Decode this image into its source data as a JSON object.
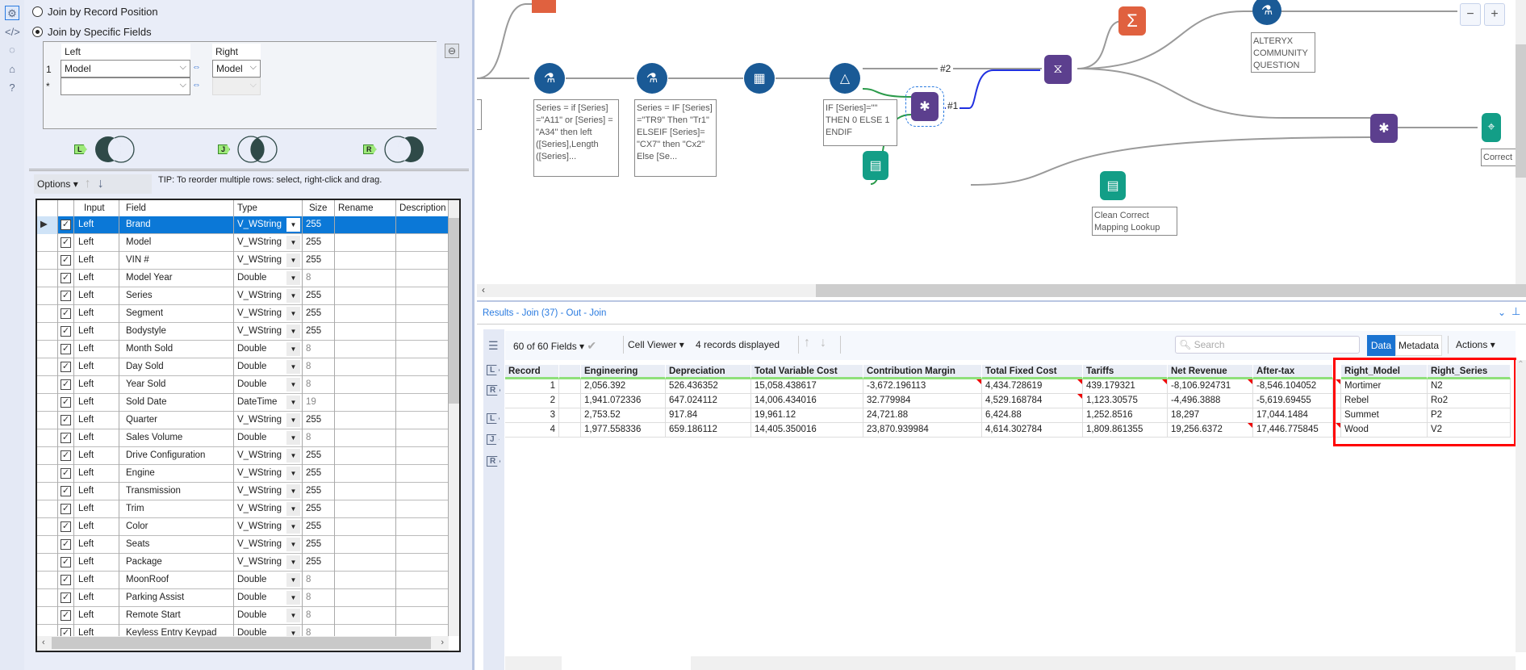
{
  "left_panel": {
    "radio_record_position": "Join by Record Position",
    "radio_specific_fields": "Join by Specific Fields",
    "join_grid": {
      "left_header": "Left",
      "right_header": "Right",
      "rows": [
        {
          "num": "1",
          "left": "Model",
          "right": "Model"
        },
        {
          "num": "*",
          "left": "",
          "right": ""
        }
      ]
    },
    "venn_tags": [
      "L",
      "J",
      "R"
    ],
    "options_label": "Options",
    "tip": "TIP: To reorder multiple rows: select, right-click and drag.",
    "columns": [
      "Input",
      "Field",
      "Type",
      "Size",
      "Rename",
      "Description"
    ],
    "fields": [
      [
        "Left",
        "Brand",
        "V_WString",
        "255"
      ],
      [
        "Left",
        "Model",
        "V_WString",
        "255"
      ],
      [
        "Left",
        "VIN #",
        "V_WString",
        "255"
      ],
      [
        "Left",
        "Model Year",
        "Double",
        "8"
      ],
      [
        "Left",
        "Series",
        "V_WString",
        "255"
      ],
      [
        "Left",
        "Segment",
        "V_WString",
        "255"
      ],
      [
        "Left",
        "Bodystyle",
        "V_WString",
        "255"
      ],
      [
        "Left",
        "Month Sold",
        "Double",
        "8"
      ],
      [
        "Left",
        "Day Sold",
        "Double",
        "8"
      ],
      [
        "Left",
        "Year Sold",
        "Double",
        "8"
      ],
      [
        "Left",
        "Sold Date",
        "DateTime",
        "19"
      ],
      [
        "Left",
        "Quarter",
        "V_WString",
        "255"
      ],
      [
        "Left",
        "Sales Volume",
        "Double",
        "8"
      ],
      [
        "Left",
        "Drive Configuration",
        "V_WString",
        "255"
      ],
      [
        "Left",
        "Engine",
        "V_WString",
        "255"
      ],
      [
        "Left",
        "Transmission",
        "V_WString",
        "255"
      ],
      [
        "Left",
        "Trim",
        "V_WString",
        "255"
      ],
      [
        "Left",
        "Color",
        "V_WString",
        "255"
      ],
      [
        "Left",
        "Seats",
        "V_WString",
        "255"
      ],
      [
        "Left",
        "Package",
        "V_WString",
        "255"
      ],
      [
        "Left",
        "MoonRoof",
        "Double",
        "8"
      ],
      [
        "Left",
        "Parking Assist",
        "Double",
        "8"
      ],
      [
        "Left",
        "Remote Start",
        "Double",
        "8"
      ],
      [
        "Left",
        "Keyless Entry Keypad",
        "Double",
        "8"
      ]
    ]
  },
  "canvas": {
    "annotations": {
      "formula1": "Series = if [Series] =\"A11\" or [Series] = \"A34\" then left ([Series],Length ([Series]...",
      "formula2": "Series = IF [Series] =\"TR9\" Then \"Tr1\" ELSEIF [Series]= \"CX7\" then \"Cx2\" Else [Se...",
      "filter": "IF [Series]=\"\" THEN 0 ELSE 1 ENDIF",
      "community": "ALTERYX COMMUNITY QUESTION",
      "lookup": "Clean Correct Mapping Lookup",
      "browse": "Correct"
    },
    "conn_labels": [
      "#2",
      "#1"
    ],
    "zoom_out": "−",
    "zoom_in": "+"
  },
  "results": {
    "title": "Results - Join (37) - Out - Join",
    "fields_selector": "60 of 60 Fields",
    "cell_viewer": "Cell Viewer",
    "records_displayed": "4 records displayed",
    "search_placeholder": "Search",
    "tab_data": "Data",
    "tab_metadata": "Metadata",
    "actions": "Actions",
    "columns": [
      "Record",
      "",
      "Engineering",
      "Depreciation",
      "Total Variable Cost",
      "Contribution Margin",
      "Total Fixed Cost",
      "Tariffs",
      "Net Revenue",
      "After-tax",
      "",
      "Right_Model",
      "Right_Series"
    ],
    "rows": [
      [
        "1",
        "",
        "2,056.392",
        "526.436352",
        "15,058.438617",
        "-3,672.196113",
        "4,434.728619",
        "439.179321",
        "-8,106.924731",
        "-8,546.104052",
        "",
        "Mortimer",
        "N2"
      ],
      [
        "2",
        "",
        "1,941.072336",
        "647.024112",
        "14,006.434016",
        "32.779984",
        "4,529.168784",
        "1,123.30575",
        "-4,496.3888",
        "-5,619.69455",
        "",
        "Rebel",
        "Ro2"
      ],
      [
        "3",
        "",
        "2,753.52",
        "917.84",
        "19,961.12",
        "24,721.88",
        "6,424.88",
        "1,252.8516",
        "18,297",
        "17,044.1484",
        "",
        "Summet",
        "P2"
      ],
      [
        "4",
        "",
        "1,977.558336",
        "659.186112",
        "14,405.350016",
        "23,870.939984",
        "4,614.302784",
        "1,809.861355",
        "19,256.6372",
        "17,446.775845",
        "",
        "Wood",
        "V2"
      ]
    ],
    "side_tags": [
      "L",
      "R",
      "L",
      "J",
      "R"
    ],
    "highlight_color": "#ff0000"
  }
}
